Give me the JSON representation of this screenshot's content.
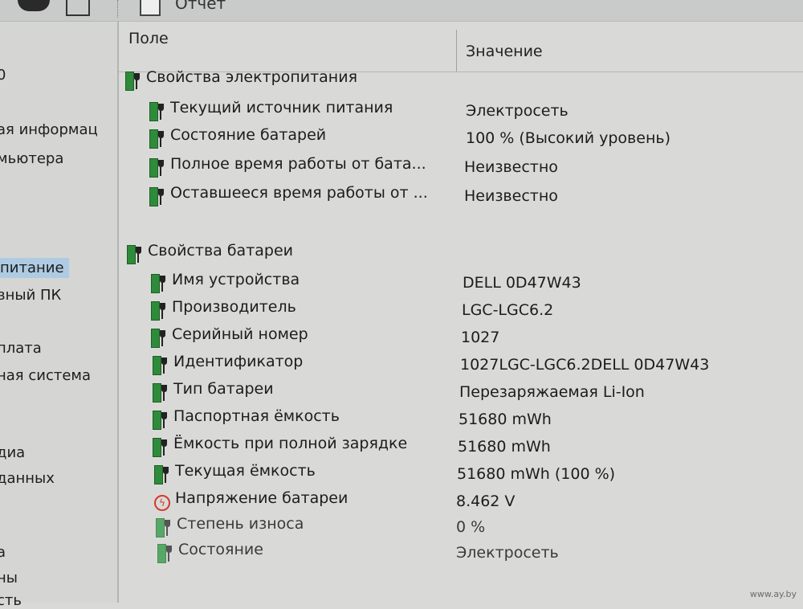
{
  "toolbar": {
    "report_label": "Отчет"
  },
  "sidebar": {
    "items": [
      "0",
      "ая информац",
      "мьютера",
      "питание",
      "вный ПК",
      "плата",
      "ная система",
      "диа",
      "данных",
      "а",
      "ны",
      "сть"
    ],
    "selected_index": 3
  },
  "table": {
    "col_field": "Поле",
    "col_value": "Значение",
    "groups": [
      {
        "title": "Свойства электропитания",
        "rows": [
          {
            "field": "Текущий источник питания",
            "value": "Электросеть"
          },
          {
            "field": "Состояние батарей",
            "value": "100 % (Высокий уровень)"
          },
          {
            "field": "Полное время работы от бата...",
            "value": "Неизвестно"
          },
          {
            "field": "Оставшееся время работы от ...",
            "value": "Неизвестно"
          }
        ]
      },
      {
        "title": "Свойства батареи",
        "rows": [
          {
            "field": "Имя устройства",
            "value": "DELL 0D47W43"
          },
          {
            "field": "Производитель",
            "value": "LGC-LGC6.2"
          },
          {
            "field": "Серийный номер",
            "value": "1027"
          },
          {
            "field": "Идентификатор",
            "value": "1027LGC-LGC6.2DELL 0D47W43"
          },
          {
            "field": "Тип батареи",
            "value": "Перезаряжаемая Li-Ion"
          },
          {
            "field": "Паспортная ёмкость",
            "value": "51680 mWh"
          },
          {
            "field": "Ёмкость при полной зарядке",
            "value": "51680 mWh"
          },
          {
            "field": "Текущая ёмкость",
            "value": "51680 mWh  (100 %)"
          },
          {
            "field": "Напряжение батареи",
            "value": "8.462 V"
          },
          {
            "field": "Степень износа",
            "value": "0 %"
          },
          {
            "field": "Состояние",
            "value": "Электросеть"
          }
        ]
      }
    ]
  },
  "watermark": "www.ay.by"
}
